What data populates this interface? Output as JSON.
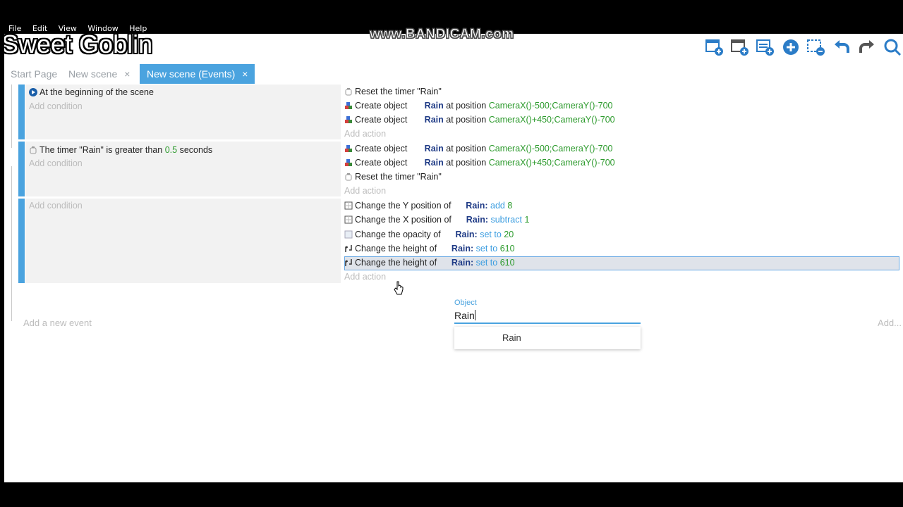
{
  "menu": [
    "File",
    "Edit",
    "View",
    "Window",
    "Help"
  ],
  "watermark": "Sweet Goblin",
  "recorder": "www.BANDICAM.com",
  "toolbar": {
    "icons": [
      "add-event-icon",
      "add-subevent-icon",
      "add-comment-icon",
      "add-more-icon",
      "delete-icon",
      "undo-icon",
      "redo-icon",
      "search-icon"
    ]
  },
  "tabs": [
    {
      "label": "Start Page"
    },
    {
      "label": "New scene",
      "close": "×"
    },
    {
      "label": "New scene (Events)",
      "close": "×"
    }
  ],
  "events": [
    {
      "conditions": [
        {
          "text": "At the beginning of the scene"
        }
      ],
      "add_condition": "Add condition",
      "actions": [
        {
          "text": "Reset the timer \"Rain\""
        },
        {
          "verb": "Create object",
          "object": "Rain",
          "mid": "at position",
          "value": "CameraX()-500;CameraY()-700"
        },
        {
          "verb": "Create object",
          "object": "Rain",
          "mid": "at position",
          "value": "CameraX()+450;CameraY()-700"
        }
      ],
      "add_action": "Add action"
    },
    {
      "conditions": [
        {
          "prefix": "The timer \"Rain\" is greater than",
          "value": "0.5",
          "suffix": "seconds"
        }
      ],
      "add_condition": "Add condition",
      "actions": [
        {
          "verb": "Create object",
          "object": "Rain",
          "mid": "at position",
          "value": "CameraX()-500;CameraY()-700"
        },
        {
          "verb": "Create object",
          "object": "Rain",
          "mid": "at position",
          "value": "CameraX()+450;CameraY()-700"
        },
        {
          "text": "Reset the timer \"Rain\""
        }
      ],
      "add_action": "Add action"
    },
    {
      "add_condition": "Add condition",
      "actions": [
        {
          "verb": "Change the Y position of",
          "object": "Rain:",
          "op": "add",
          "value": "8"
        },
        {
          "verb": "Change the X position of",
          "object": "Rain:",
          "op": "subtract",
          "value": "1"
        },
        {
          "verb": "Change the opacity of",
          "object": "Rain:",
          "op": "set to",
          "value": "20"
        },
        {
          "verb": "Change the height of",
          "object": "Rain:",
          "op": "set to",
          "value": "610"
        },
        {
          "verb": "Change the height of",
          "object": "Rain:",
          "op": "set to",
          "value": "610"
        }
      ],
      "add_action": "Add action"
    }
  ],
  "add_event": "Add a new event",
  "add_right": "Add...",
  "object_popup": {
    "label": "Object",
    "value": "Rain",
    "options": [
      "Rain"
    ]
  }
}
